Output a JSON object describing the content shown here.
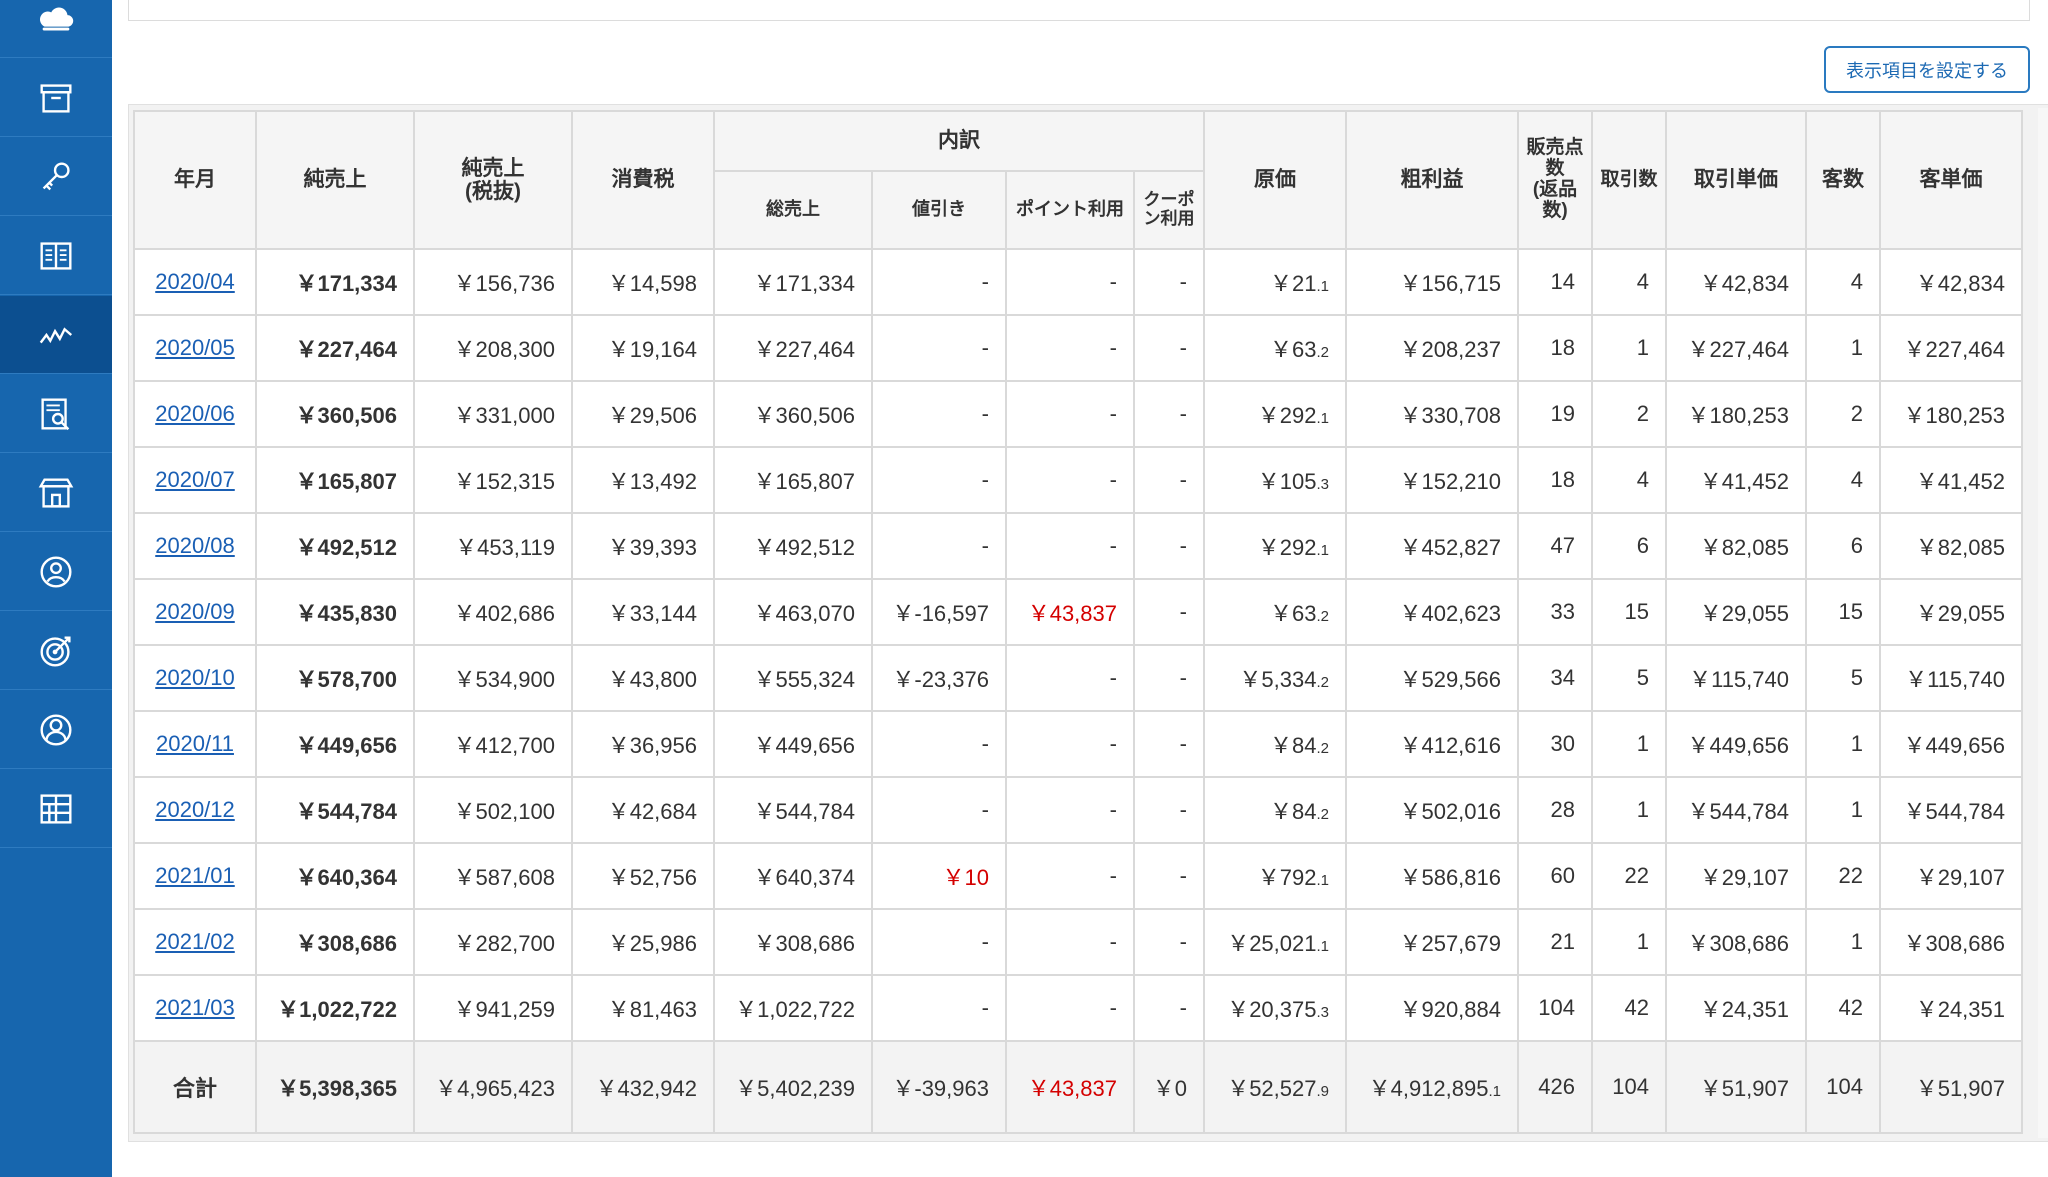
{
  "sidebar": {
    "items": [
      {
        "icon": "cloud-icon"
      },
      {
        "icon": "archive-box-icon"
      },
      {
        "icon": "key-icon"
      },
      {
        "icon": "book-icon"
      },
      {
        "icon": "line-chart-icon",
        "active": true
      },
      {
        "icon": "document-search-icon"
      },
      {
        "icon": "store-icon"
      },
      {
        "icon": "user-circle-icon"
      },
      {
        "icon": "target-icon"
      },
      {
        "icon": "person-icon"
      },
      {
        "icon": "grid-icon"
      }
    ]
  },
  "toolbar": {
    "settings_label": "表示項目を設定する"
  },
  "table": {
    "headers": {
      "month": "年月",
      "net_sales": "純売上",
      "net_sales_ex_tax_1": "純売上",
      "net_sales_ex_tax_2": "(税抜)",
      "consumption_tax": "消費税",
      "breakdown": "内訳",
      "gross_sales": "総売上",
      "discount": "値引き",
      "points": "ポイント利用",
      "coupon_1": "クーポ",
      "coupon_2": "ン利用",
      "cost": "原価",
      "gross_profit": "粗利益",
      "units_1": "販売点",
      "units_2": "数",
      "units_3": "(返品",
      "units_4": "数)",
      "transactions": "取引数",
      "avg_transaction": "取引単価",
      "customers": "客数",
      "avg_customer": "客単価"
    },
    "rows": [
      {
        "month": "2020/04",
        "net_sales": "￥171,334",
        "net_ex_tax": "￥156,736",
        "tax": "￥14,598",
        "gross": "￥171,334",
        "discount": "-",
        "points": "-",
        "coupon": "-",
        "cost": "￥21",
        "cost_dec": ".1",
        "profit": "￥156,715",
        "profit_dec": "",
        "units": "14",
        "trans": "4",
        "avg_trans": "￥42,834",
        "customers": "4",
        "avg_cust": "￥42,834"
      },
      {
        "month": "2020/05",
        "net_sales": "￥227,464",
        "net_ex_tax": "￥208,300",
        "tax": "￥19,164",
        "gross": "￥227,464",
        "discount": "-",
        "points": "-",
        "coupon": "-",
        "cost": "￥63",
        "cost_dec": ".2",
        "profit": "￥208,237",
        "profit_dec": "",
        "units": "18",
        "trans": "1",
        "avg_trans": "￥227,464",
        "customers": "1",
        "avg_cust": "￥227,464"
      },
      {
        "month": "2020/06",
        "net_sales": "￥360,506",
        "net_ex_tax": "￥331,000",
        "tax": "￥29,506",
        "gross": "￥360,506",
        "discount": "-",
        "points": "-",
        "coupon": "-",
        "cost": "￥292",
        "cost_dec": ".1",
        "profit": "￥330,708",
        "profit_dec": "",
        "units": "19",
        "trans": "2",
        "avg_trans": "￥180,253",
        "customers": "2",
        "avg_cust": "￥180,253"
      },
      {
        "month": "2020/07",
        "net_sales": "￥165,807",
        "net_ex_tax": "￥152,315",
        "tax": "￥13,492",
        "gross": "￥165,807",
        "discount": "-",
        "points": "-",
        "coupon": "-",
        "cost": "￥105",
        "cost_dec": ".3",
        "profit": "￥152,210",
        "profit_dec": "",
        "units": "18",
        "trans": "4",
        "avg_trans": "￥41,452",
        "customers": "4",
        "avg_cust": "￥41,452"
      },
      {
        "month": "2020/08",
        "net_sales": "￥492,512",
        "net_ex_tax": "￥453,119",
        "tax": "￥39,393",
        "gross": "￥492,512",
        "discount": "-",
        "points": "-",
        "coupon": "-",
        "cost": "￥292",
        "cost_dec": ".1",
        "profit": "￥452,827",
        "profit_dec": "",
        "units": "47",
        "trans": "6",
        "avg_trans": "￥82,085",
        "customers": "6",
        "avg_cust": "￥82,085"
      },
      {
        "month": "2020/09",
        "net_sales": "￥435,830",
        "net_ex_tax": "￥402,686",
        "tax": "￥33,144",
        "gross": "￥463,070",
        "discount": "￥-16,597",
        "points": "￥43,837",
        "points_red": true,
        "coupon": "-",
        "cost": "￥63",
        "cost_dec": ".2",
        "profit": "￥402,623",
        "profit_dec": "",
        "units": "33",
        "trans": "15",
        "avg_trans": "￥29,055",
        "customers": "15",
        "avg_cust": "￥29,055"
      },
      {
        "month": "2020/10",
        "net_sales": "￥578,700",
        "net_ex_tax": "￥534,900",
        "tax": "￥43,800",
        "gross": "￥555,324",
        "discount": "￥-23,376",
        "points": "-",
        "coupon": "-",
        "cost": "￥5,334",
        "cost_dec": ".2",
        "profit": "￥529,566",
        "profit_dec": "",
        "units": "34",
        "trans": "5",
        "avg_trans": "￥115,740",
        "customers": "5",
        "avg_cust": "￥115,740"
      },
      {
        "month": "2020/11",
        "net_sales": "￥449,656",
        "net_ex_tax": "￥412,700",
        "tax": "￥36,956",
        "gross": "￥449,656",
        "discount": "-",
        "points": "-",
        "coupon": "-",
        "cost": "￥84",
        "cost_dec": ".2",
        "profit": "￥412,616",
        "profit_dec": "",
        "units": "30",
        "trans": "1",
        "avg_trans": "￥449,656",
        "customers": "1",
        "avg_cust": "￥449,656"
      },
      {
        "month": "2020/12",
        "net_sales": "￥544,784",
        "net_ex_tax": "￥502,100",
        "tax": "￥42,684",
        "gross": "￥544,784",
        "discount": "-",
        "points": "-",
        "coupon": "-",
        "cost": "￥84",
        "cost_dec": ".2",
        "profit": "￥502,016",
        "profit_dec": "",
        "units": "28",
        "trans": "1",
        "avg_trans": "￥544,784",
        "customers": "1",
        "avg_cust": "￥544,784"
      },
      {
        "month": "2021/01",
        "net_sales": "￥640,364",
        "net_ex_tax": "￥587,608",
        "tax": "￥52,756",
        "gross": "￥640,374",
        "discount": "￥10",
        "discount_red": true,
        "points": "-",
        "coupon": "-",
        "cost": "￥792",
        "cost_dec": ".1",
        "profit": "￥586,816",
        "profit_dec": "",
        "units": "60",
        "trans": "22",
        "avg_trans": "￥29,107",
        "customers": "22",
        "avg_cust": "￥29,107"
      },
      {
        "month": "2021/02",
        "net_sales": "￥308,686",
        "net_ex_tax": "￥282,700",
        "tax": "￥25,986",
        "gross": "￥308,686",
        "discount": "-",
        "points": "-",
        "coupon": "-",
        "cost": "￥25,021",
        "cost_dec": ".1",
        "profit": "￥257,679",
        "profit_dec": "",
        "units": "21",
        "trans": "1",
        "avg_trans": "￥308,686",
        "customers": "1",
        "avg_cust": "￥308,686"
      },
      {
        "month": "2021/03",
        "net_sales": "￥1,022,722",
        "net_ex_tax": "￥941,259",
        "tax": "￥81,463",
        "gross": "￥1,022,722",
        "discount": "-",
        "points": "-",
        "coupon": "-",
        "cost": "￥20,375",
        "cost_dec": ".3",
        "profit": "￥920,884",
        "profit_dec": "",
        "units": "104",
        "trans": "42",
        "avg_trans": "￥24,351",
        "customers": "42",
        "avg_cust": "￥24,351"
      }
    ],
    "total": {
      "label": "合計",
      "net_sales": "￥5,398,365",
      "net_ex_tax": "￥4,965,423",
      "tax": "￥432,942",
      "gross": "￥5,402,239",
      "discount": "￥-39,963",
      "points": "￥43,837",
      "points_red": true,
      "coupon": "￥0",
      "cost": "￥52,527",
      "cost_dec": ".9",
      "profit": "￥4,912,895",
      "profit_dec": ".1",
      "units": "426",
      "trans": "104",
      "avg_trans": "￥51,907",
      "customers": "104",
      "avg_cust": "￥51,907"
    }
  }
}
